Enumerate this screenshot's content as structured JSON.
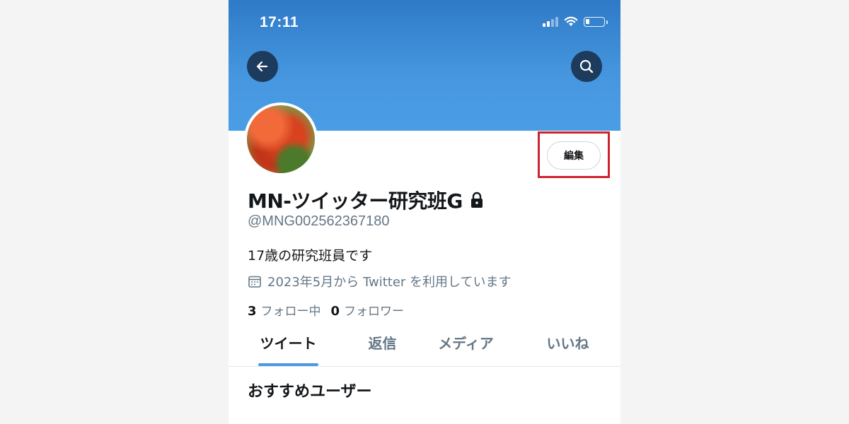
{
  "status_bar": {
    "time": "17:11"
  },
  "profile": {
    "display_name": "MN-ツイッター研究班G",
    "handle": "@MNG002562367180",
    "bio": "17歳の研究班員です",
    "joined": "2023年5月から Twitter を利用しています",
    "following_count": "3",
    "following_label": "フォロー中",
    "followers_count": "0",
    "followers_label": "フォロワー"
  },
  "header": {
    "edit_label": "編集"
  },
  "tabs": [
    {
      "label": "ツイート",
      "active": true
    },
    {
      "label": "返信",
      "active": false
    },
    {
      "label": "メディア",
      "active": false
    },
    {
      "label": "いいね",
      "active": false
    }
  ],
  "section": {
    "title": "おすすめユーザー"
  },
  "colors": {
    "banner": "#4797e0",
    "highlight": "#d0222c",
    "tab_indicator": "#4a99e9"
  },
  "battery_level": 0.2,
  "icons": [
    "back-arrow-icon",
    "search-icon",
    "lock-icon",
    "calendar-icon",
    "wifi-icon",
    "signal-icon",
    "battery-icon"
  ]
}
